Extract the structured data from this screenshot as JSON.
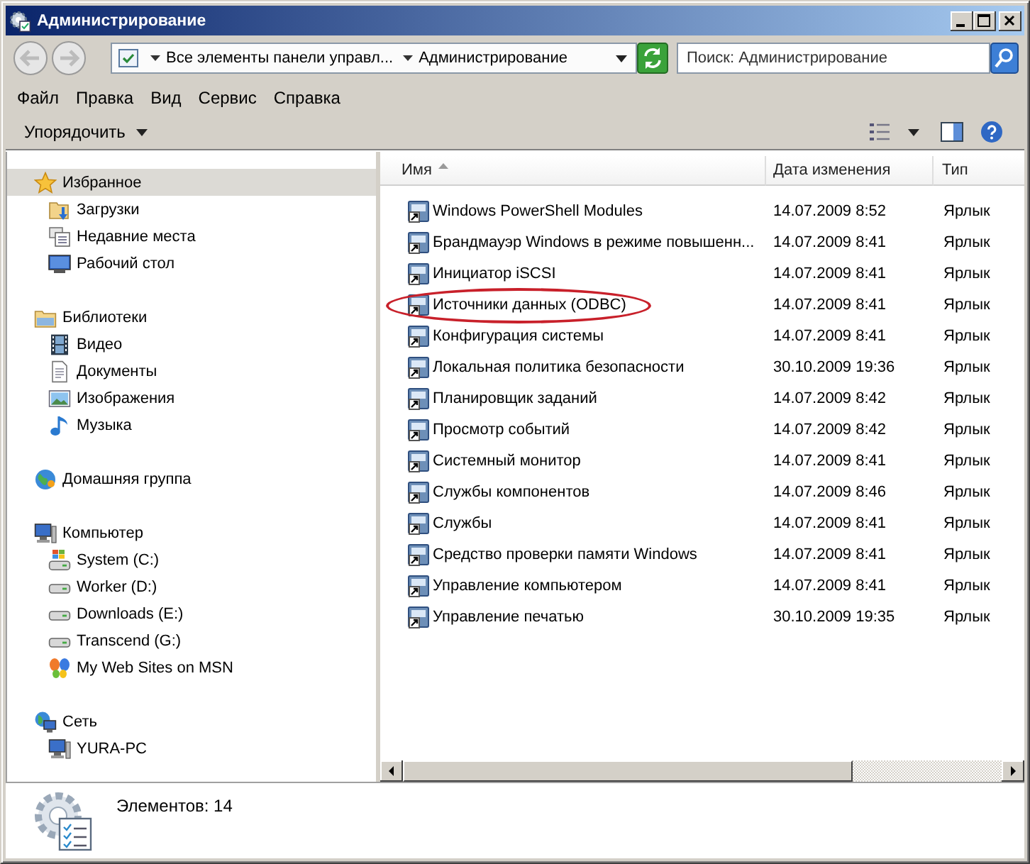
{
  "window": {
    "title": "Администрирование"
  },
  "nav_buttons": [
    {
      "kind": "back",
      "disabled": true
    },
    {
      "kind": "forward",
      "disabled": true
    }
  ],
  "address_bar": {
    "path": [
      "Все элементы панели управл...",
      "Администрирование"
    ]
  },
  "search": {
    "placeholder": "Поиск: Администрирование"
  },
  "menu": [
    "Файл",
    "Правка",
    "Вид",
    "Сервис",
    "Справка"
  ],
  "toolbar": {
    "organize": "Упорядочить"
  },
  "nav": {
    "groups": [
      {
        "label": "Избранное",
        "kind": "favorites",
        "selected": true,
        "children": [
          {
            "label": "Загрузки",
            "kind": "downloads",
            "selected": false
          },
          {
            "label": "Недавние места",
            "kind": "recent",
            "selected": false
          },
          {
            "label": "Рабочий стол",
            "kind": "desktop",
            "selected": false
          }
        ]
      },
      {
        "label": "Библиотеки",
        "kind": "libraries",
        "selected": false,
        "children": [
          {
            "label": "Видео",
            "kind": "video",
            "selected": false
          },
          {
            "label": "Документы",
            "kind": "documents",
            "selected": false
          },
          {
            "label": "Изображения",
            "kind": "pictures",
            "selected": false
          },
          {
            "label": "Музыка",
            "kind": "music",
            "selected": false
          }
        ]
      },
      {
        "label": "Домашняя группа",
        "kind": "homegroup",
        "selected": false
      },
      {
        "label": "Компьютер",
        "kind": "computer",
        "selected": false,
        "children": [
          {
            "label": "System (C:)",
            "kind": "system-drive",
            "selected": false
          },
          {
            "label": "Worker (D:)",
            "kind": "drive",
            "selected": false
          },
          {
            "label": "Downloads (E:)",
            "kind": "drive",
            "selected": false
          },
          {
            "label": "Transcend (G:)",
            "kind": "drive",
            "selected": false
          },
          {
            "label": "My Web Sites on MSN",
            "kind": "msn",
            "selected": false
          }
        ]
      },
      {
        "label": "Сеть",
        "kind": "network",
        "selected": false,
        "children": [
          {
            "label": "YURA-PC",
            "kind": "pc",
            "selected": false
          }
        ]
      }
    ]
  },
  "file_list": {
    "columns": [
      {
        "label": "Имя",
        "sorted": true
      },
      {
        "label": "Дата изменения",
        "sorted": false
      },
      {
        "label": "Тип",
        "sorted": false
      }
    ],
    "rows": [
      {
        "name": "Windows PowerShell Modules",
        "date": "14.07.2009 8:52",
        "type": "Ярлык",
        "circled": false
      },
      {
        "name": "Брандмауэр Windows в режиме повышенн...",
        "date": "14.07.2009 8:41",
        "type": "Ярлык",
        "circled": false
      },
      {
        "name": "Инициатор iSCSI",
        "date": "14.07.2009 8:41",
        "type": "Ярлык",
        "circled": false
      },
      {
        "name": "Источники данных (ODBC)",
        "date": "14.07.2009 8:41",
        "type": "Ярлык",
        "circled": true
      },
      {
        "name": "Конфигурация системы",
        "date": "14.07.2009 8:41",
        "type": "Ярлык",
        "circled": false
      },
      {
        "name": "Локальная политика безопасности",
        "date": "30.10.2009 19:36",
        "type": "Ярлык",
        "circled": false
      },
      {
        "name": "Планировщик заданий",
        "date": "14.07.2009 8:42",
        "type": "Ярлык",
        "circled": false
      },
      {
        "name": "Просмотр событий",
        "date": "14.07.2009 8:42",
        "type": "Ярлык",
        "circled": false
      },
      {
        "name": "Системный монитор",
        "date": "14.07.2009 8:41",
        "type": "Ярлык",
        "circled": false
      },
      {
        "name": "Службы компонентов",
        "date": "14.07.2009 8:46",
        "type": "Ярлык",
        "circled": false
      },
      {
        "name": "Службы",
        "date": "14.07.2009 8:41",
        "type": "Ярлык",
        "circled": false
      },
      {
        "name": "Средство проверки памяти Windows",
        "date": "14.07.2009 8:41",
        "type": "Ярлык",
        "circled": false
      },
      {
        "name": "Управление компьютером",
        "date": "14.07.2009 8:41",
        "type": "Ярлык",
        "circled": false
      },
      {
        "name": "Управление печатью",
        "date": "30.10.2009 19:35",
        "type": "Ярлык",
        "circled": false
      }
    ]
  },
  "status_bar": {
    "text": "Элементов: 14"
  }
}
